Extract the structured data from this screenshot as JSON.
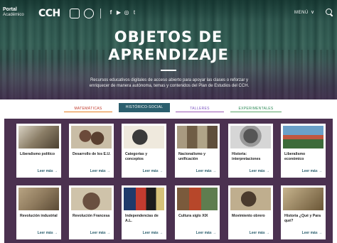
{
  "header": {
    "logo_portal": "Portal",
    "logo_academico": "Académico",
    "logo_cch": "CCH",
    "social": [
      "f",
      "▶",
      "◎",
      "t"
    ],
    "menu_label": "MENÚ",
    "menu_chevron": "∨"
  },
  "hero": {
    "title_line1": "OBJETOS DE",
    "title_line2": "APRENDIZAJE",
    "subtitle": "Recursos educativos digitales de acceso abierto para apoyar las clases o reforzar y enriquecer de manera autónoma, temas y contenidos del Plan de Estudios del CCH."
  },
  "tabs": [
    {
      "label": "MATEMÁTICAS",
      "active": false
    },
    {
      "label": "HISTÓRICO-SOCIAL",
      "active": true
    },
    {
      "label": "TALLERES",
      "active": false
    },
    {
      "label": "EXPERIMENTALES",
      "active": false
    }
  ],
  "colors": {
    "accent": "#2c5f6e",
    "grid_background": "#4b3150"
  },
  "cards": [
    {
      "title": "Liberalismo político",
      "link": "Leer más →"
    },
    {
      "title": "Desarrollo de los E.U.",
      "link": "Leer más →"
    },
    {
      "title": "Categorías y conceptos",
      "link": "Leer más →"
    },
    {
      "title": "Nacionalismo y unificación",
      "link": "Leer más →"
    },
    {
      "title": "Historia: interpretaciones",
      "link": "Leer más →"
    },
    {
      "title": "Liberalismo económico",
      "link": "Leer más →"
    },
    {
      "title": "Revolución industrial",
      "link": "Leer más →"
    },
    {
      "title": "Revolución Francesa",
      "link": "Leer más →"
    },
    {
      "title": "Independencias de A.L.",
      "link": "Leer más →"
    },
    {
      "title": "Cultura siglo XIX",
      "link": "Leer más →"
    },
    {
      "title": "Movimiento obrero",
      "link": "Leer más →"
    },
    {
      "title": "Historia ¿Qué y Para qué?",
      "link": "Leer más →"
    }
  ]
}
